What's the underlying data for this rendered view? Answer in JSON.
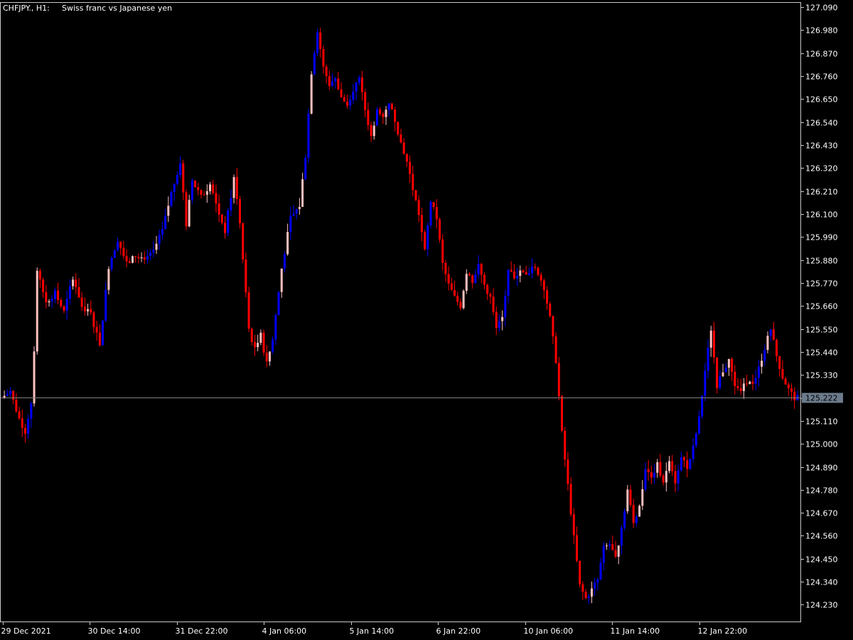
{
  "header": {
    "symbol": "CHFJPY., H1:",
    "description": "Swiss franc vs Japanese yen"
  },
  "colors": {
    "background": "#000000",
    "frame": "#c8c8c8",
    "text": "#ffffff",
    "bull": "#0000ff",
    "bear": "#ff0000",
    "bull_alt": "#ffc0c0",
    "price_line": "#808080",
    "price_tag_bg": "#6c7b8b"
  },
  "chart_data": {
    "type": "candlestick",
    "symbol": "CHFJPY",
    "timeframe": "H1",
    "ylim": [
      124.15,
      127.11
    ],
    "y_ticks": [
      127.09,
      126.98,
      126.87,
      126.76,
      126.65,
      126.54,
      126.43,
      126.32,
      126.21,
      126.1,
      125.99,
      125.88,
      125.77,
      125.66,
      125.55,
      125.44,
      125.33,
      125.22,
      125.11,
      125.0,
      124.89,
      124.78,
      124.67,
      124.56,
      124.45,
      124.34,
      124.23
    ],
    "y_tick_labels": [
      "127.090",
      "126.980",
      "126.870",
      "126.760",
      "126.650",
      "126.540",
      "126.430",
      "126.320",
      "126.210",
      "126.100",
      "125.990",
      "125.880",
      "125.770",
      "125.660",
      "125.550",
      "125.440",
      "125.330",
      "125.220",
      "125.110",
      "125.000",
      "124.890",
      "124.780",
      "124.670",
      "124.560",
      "124.450",
      "124.340",
      "124.230"
    ],
    "x_tick_labels": [
      "29 Dec 2021",
      "30 Dec 14:00",
      "31 Dec 22:00",
      "4 Jan 06:00",
      "5 Jan 14:00",
      "6 Jan 22:00",
      "10 Jan 06:00",
      "11 Jan 14:00",
      "12 Jan 22:00"
    ],
    "current_price": 125.222,
    "current_price_label": "125.222",
    "anchors": [
      [
        0,
        125.22
      ],
      [
        3,
        125.25
      ],
      [
        6,
        125.12
      ],
      [
        8,
        125.06
      ],
      [
        10,
        125.2
      ],
      [
        11,
        125.45
      ],
      [
        12,
        125.82
      ],
      [
        15,
        125.68
      ],
      [
        18,
        125.72
      ],
      [
        21,
        125.63
      ],
      [
        24,
        125.8
      ],
      [
        27,
        125.66
      ],
      [
        30,
        125.62
      ],
      [
        33,
        125.48
      ],
      [
        36,
        125.85
      ],
      [
        39,
        125.98
      ],
      [
        42,
        125.86
      ],
      [
        45,
        125.9
      ],
      [
        48,
        125.87
      ],
      [
        51,
        125.92
      ],
      [
        54,
        126.02
      ],
      [
        57,
        126.2
      ],
      [
        60,
        126.35
      ],
      [
        62,
        126.05
      ],
      [
        64,
        126.26
      ],
      [
        67,
        126.18
      ],
      [
        70,
        126.24
      ],
      [
        73,
        126.1
      ],
      [
        75,
        126.02
      ],
      [
        78,
        126.27
      ],
      [
        80,
        126.06
      ],
      [
        81,
        125.88
      ],
      [
        83,
        125.55
      ],
      [
        85,
        125.45
      ],
      [
        87,
        125.52
      ],
      [
        89,
        125.38
      ],
      [
        91,
        125.5
      ],
      [
        94,
        125.84
      ],
      [
        97,
        126.08
      ],
      [
        100,
        126.14
      ],
      [
        102,
        126.38
      ],
      [
        104,
        126.78
      ],
      [
        106,
        126.98
      ],
      [
        108,
        126.8
      ],
      [
        110,
        126.72
      ],
      [
        112,
        126.75
      ],
      [
        114,
        126.66
      ],
      [
        116,
        126.62
      ],
      [
        118,
        126.7
      ],
      [
        120,
        126.74
      ],
      [
        122,
        126.6
      ],
      [
        124,
        126.47
      ],
      [
        126,
        126.6
      ],
      [
        128,
        126.55
      ],
      [
        130,
        126.64
      ],
      [
        132,
        126.55
      ],
      [
        134,
        126.44
      ],
      [
        136,
        126.35
      ],
      [
        138,
        126.22
      ],
      [
        140,
        126.1
      ],
      [
        142,
        125.92
      ],
      [
        144,
        126.16
      ],
      [
        146,
        126.08
      ],
      [
        148,
        125.86
      ],
      [
        150,
        125.76
      ],
      [
        152,
        125.7
      ],
      [
        154,
        125.66
      ],
      [
        156,
        125.82
      ],
      [
        158,
        125.78
      ],
      [
        160,
        125.85
      ],
      [
        162,
        125.76
      ],
      [
        164,
        125.7
      ],
      [
        166,
        125.55
      ],
      [
        168,
        125.6
      ],
      [
        170,
        125.84
      ],
      [
        172,
        125.8
      ],
      [
        174,
        125.83
      ],
      [
        176,
        125.8
      ],
      [
        178,
        125.85
      ],
      [
        180,
        125.82
      ],
      [
        182,
        125.75
      ],
      [
        184,
        125.6
      ],
      [
        186,
        125.4
      ],
      [
        188,
        125.05
      ],
      [
        190,
        124.8
      ],
      [
        192,
        124.55
      ],
      [
        194,
        124.32
      ],
      [
        196,
        124.26
      ],
      [
        198,
        124.3
      ],
      [
        200,
        124.35
      ],
      [
        202,
        124.5
      ],
      [
        204,
        124.52
      ],
      [
        206,
        124.45
      ],
      [
        208,
        124.6
      ],
      [
        210,
        124.78
      ],
      [
        212,
        124.62
      ],
      [
        214,
        124.7
      ],
      [
        216,
        124.88
      ],
      [
        218,
        124.85
      ],
      [
        220,
        124.9
      ],
      [
        222,
        124.82
      ],
      [
        224,
        124.92
      ],
      [
        226,
        124.82
      ],
      [
        228,
        124.95
      ],
      [
        230,
        124.88
      ],
      [
        232,
        124.98
      ],
      [
        234,
        125.12
      ],
      [
        236,
        125.35
      ],
      [
        238,
        125.55
      ],
      [
        240,
        125.28
      ],
      [
        242,
        125.35
      ],
      [
        244,
        125.4
      ],
      [
        246,
        125.28
      ],
      [
        248,
        125.25
      ],
      [
        250,
        125.3
      ],
      [
        252,
        125.28
      ],
      [
        254,
        125.36
      ],
      [
        256,
        125.46
      ],
      [
        258,
        125.55
      ],
      [
        260,
        125.42
      ],
      [
        262,
        125.32
      ],
      [
        264,
        125.26
      ],
      [
        266,
        125.22
      ]
    ]
  }
}
